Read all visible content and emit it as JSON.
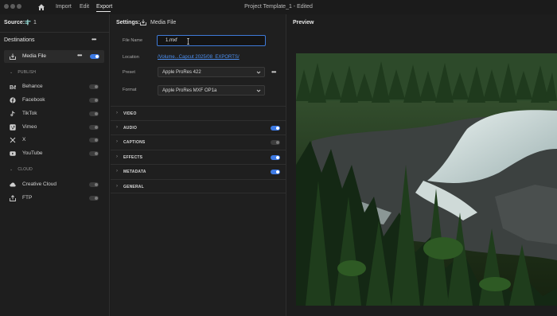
{
  "titlebar": {
    "nav": [
      "Import",
      "Edit",
      "Export"
    ],
    "active_tab": "Export",
    "window_title": "Project Template_1 - Edited"
  },
  "left_panel": {
    "source_label": "Source:",
    "source_count": "1",
    "destinations_title": "Destinations",
    "media_file": {
      "label": "Media File",
      "enabled": true
    },
    "publish_section": "PUBLISH",
    "publish_items": [
      {
        "label": "Behance",
        "icon": "behance-icon",
        "enabled": false
      },
      {
        "label": "Facebook",
        "icon": "facebook-icon",
        "enabled": false
      },
      {
        "label": "TikTok",
        "icon": "tiktok-icon",
        "enabled": false
      },
      {
        "label": "Vimeo",
        "icon": "vimeo-icon",
        "enabled": false
      },
      {
        "label": "X",
        "icon": "x-icon",
        "enabled": false
      },
      {
        "label": "YouTube",
        "icon": "youtube-icon",
        "enabled": false
      }
    ],
    "cloud_section": "CLOUD",
    "cloud_items": [
      {
        "label": "Creative Cloud",
        "icon": "creative-cloud-icon",
        "enabled": false
      },
      {
        "label": "FTP",
        "icon": "ftp-icon",
        "enabled": false
      }
    ]
  },
  "settings_panel": {
    "title": "Settings:",
    "target": "Media File",
    "file_name_label": "File Name",
    "file_name_value": "1.mxf",
    "location_label": "Location",
    "location_value": "/Volume...Capcut 2025/08_EXPORTS/",
    "preset_label": "Preset",
    "preset_value": "Apple ProRes 422",
    "format_label": "Format",
    "format_value": "Apple ProRes MXF OP1a",
    "sections": [
      {
        "label": "VIDEO",
        "toggle": null
      },
      {
        "label": "AUDIO",
        "toggle": true
      },
      {
        "label": "CAPTIONS",
        "toggle": false
      },
      {
        "label": "EFFECTS",
        "toggle": true
      },
      {
        "label": "METADATA",
        "toggle": true
      },
      {
        "label": "GENERAL",
        "toggle": null
      }
    ]
  },
  "preview_panel": {
    "title": "Preview"
  },
  "colors": {
    "accent": "#3d7ae5",
    "link": "#4c8ff0",
    "background": "#1d1d1d"
  }
}
